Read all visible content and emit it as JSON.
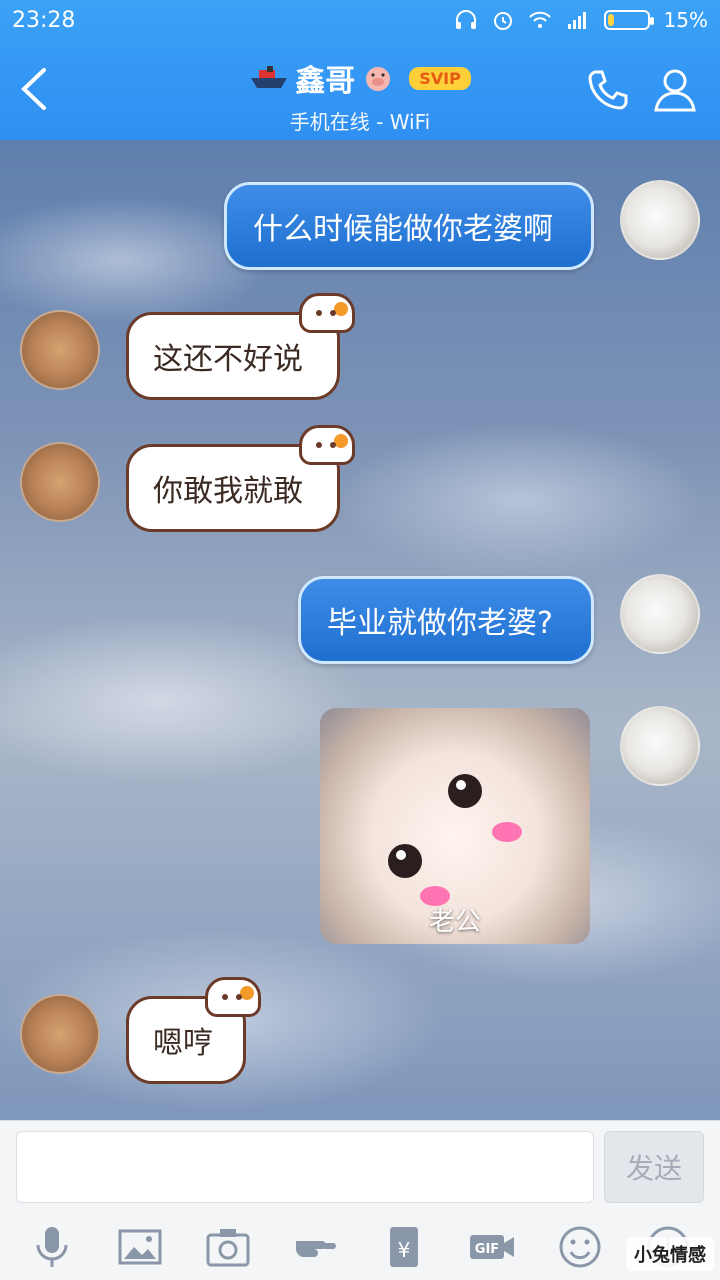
{
  "status_bar": {
    "time": "23:28",
    "battery": "15%",
    "battery_level": 0.15
  },
  "header": {
    "title": "鑫哥",
    "badge": "SVIP",
    "subtitle": "手机在线 - WiFi"
  },
  "messages": [
    {
      "side": "out",
      "text": "什么时候能做你老婆啊"
    },
    {
      "side": "in",
      "text": "这还不好说"
    },
    {
      "side": "in",
      "text": "你敢我就敢"
    },
    {
      "side": "out",
      "text": "毕业就做你老婆?"
    },
    {
      "side": "out",
      "type": "sticker",
      "caption": "老公"
    },
    {
      "side": "in",
      "text": "嗯哼"
    }
  ],
  "input": {
    "value": "",
    "send_label": "发送"
  },
  "toolbar": [
    "mic-icon",
    "image-icon",
    "camera-icon",
    "poke-icon",
    "red-packet-icon",
    "gif-icon",
    "emoji-icon",
    "more-icon"
  ],
  "watermark": "小兔情感",
  "colors": {
    "header": "#2f8ff2",
    "bubble_out": "#1f6fd0",
    "bubble_in_border": "#6b3a28"
  }
}
